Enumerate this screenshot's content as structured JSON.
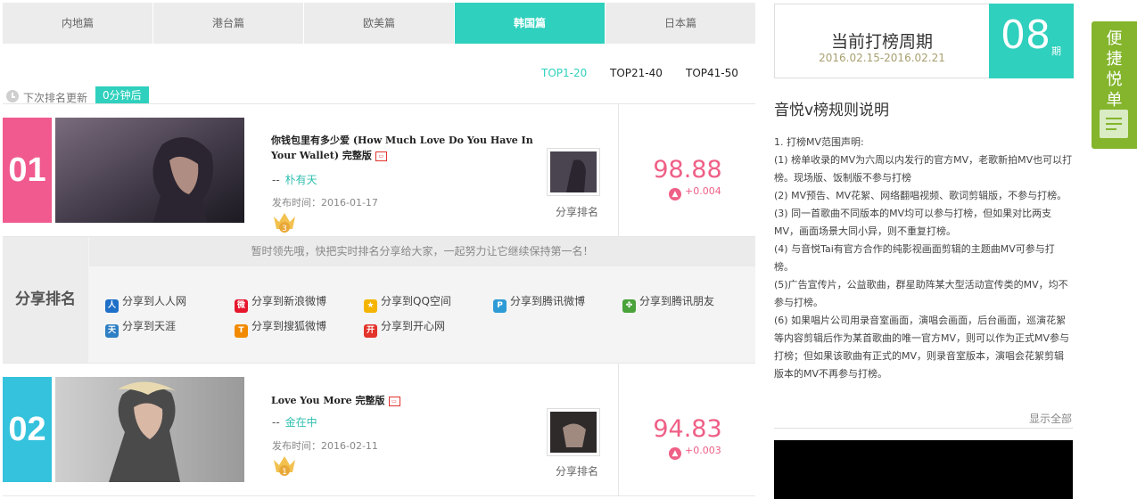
{
  "tabs": [
    {
      "label": "内地篇",
      "active": false
    },
    {
      "label": "港台篇",
      "active": false
    },
    {
      "label": "欧美篇",
      "active": false
    },
    {
      "label": "韩国篇",
      "active": true
    },
    {
      "label": "日本篇",
      "active": false
    }
  ],
  "ranges": [
    {
      "label": "TOP1-20",
      "active": true
    },
    {
      "label": "TOP21-40",
      "active": false
    },
    {
      "label": "TOP41-50",
      "active": false
    }
  ],
  "update": {
    "label": "下次排名更新",
    "value": "0分钟后"
  },
  "entries": [
    {
      "rank": "01",
      "rank_color": "#f05a8e",
      "title": "你钱包里有多少爱 (How Much Love Do You Have In Your Wallet) 完整版",
      "artist_prefix": "--",
      "artist": "朴有天",
      "release": "发布时间：2016-01-17",
      "crown_number": "3",
      "share_label": "分享排名",
      "score": "98.88",
      "trend": "+0.004"
    },
    {
      "rank": "02",
      "rank_color": "#34c2dd",
      "title": "Love You More 完整版",
      "artist_prefix": "--",
      "artist": "金在中",
      "release": "发布时间：2016-02-11",
      "crown_number": "1",
      "share_label": "分享排名",
      "score": "94.83",
      "trend": "+0.003"
    }
  ],
  "share": {
    "side_label": "分享排名",
    "message": "暂时领先哦，快把实时排名分享给大家，一起努力让它继续保持第一名！",
    "items": [
      {
        "label": "分享到人人网",
        "icon": "renren-icon",
        "color": "#1e6fc8"
      },
      {
        "label": "分享到新浪微博",
        "icon": "weibo-icon",
        "color": "#e6162d"
      },
      {
        "label": "分享到QQ空间",
        "icon": "qzone-icon",
        "color": "#f5b400"
      },
      {
        "label": "分享到腾讯微博",
        "icon": "tencent-weibo-icon",
        "color": "#2f9bd6"
      },
      {
        "label": "分享到腾讯朋友",
        "icon": "pengyou-icon",
        "color": "#4aa23a"
      },
      {
        "label": "分享到天涯",
        "icon": "tianya-icon",
        "color": "#2e7fc4"
      },
      {
        "label": "分享到搜狐微博",
        "icon": "sohu-icon",
        "color": "#f28a00"
      },
      {
        "label": "分享到开心网",
        "icon": "kaixin-icon",
        "color": "#e3342b"
      }
    ]
  },
  "period": {
    "title": "当前打榜周期",
    "dates": "2016.02.15-2016.02.21",
    "number": "08",
    "unit": "期"
  },
  "rules": {
    "title": "音悦v榜规则说明",
    "lines": [
      "1. 打榜MV范围声明:",
      "(1) 榜单收录的MV为六周以内发行的官方MV，老歌新拍MV也可以打榜。现场版、饭制版不参与打榜",
      "(2) MV预告、MV花絮、网络翻唱视频、歌词剪辑版，不参与打榜。",
      "(3) 同一首歌曲不同版本的MV均可以参与打榜，但如果对比两支MV，画面场景大同小异，则不重复打榜。",
      "(4) 与音悦Tai有官方合作的纯影视画面剪辑的主题曲MV可参与打榜。",
      "(5)广告宣传片，公益歌曲，群星助阵某大型活动宣传类的MV，均不参与打榜。",
      "(6) 如果唱片公司用录音室画面，演唱会画面，后台画面，巡演花絮等内容剪辑后作为某首歌曲的唯一官方MV，则可以作为正式MV参与打榜；但如果该歌曲有正式的MV，则录音室版本，演唱会花絮剪辑版本的MV不再参与打榜。"
    ],
    "show_all": "显示全部"
  },
  "quick_menu": {
    "label": "便捷悦单",
    "icon": "playlist-icon"
  }
}
